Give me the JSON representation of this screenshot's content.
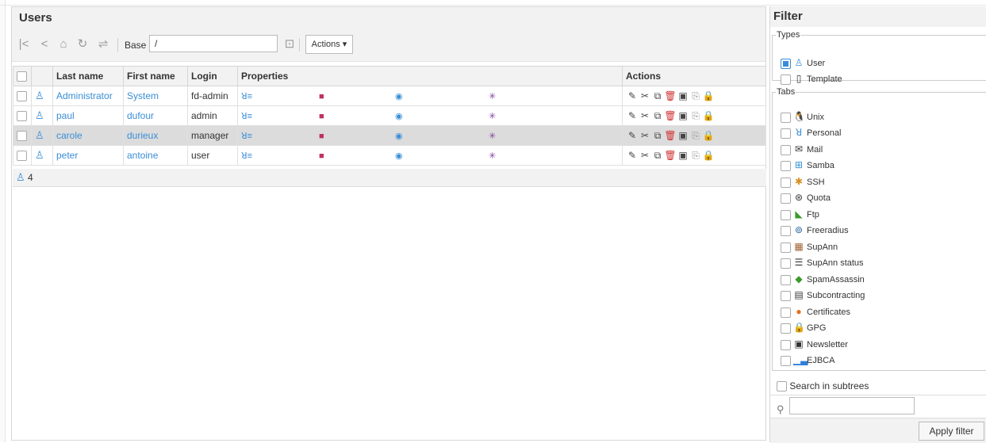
{
  "main": {
    "title": "Users",
    "toolbar": {
      "base_label": "Base",
      "base_value": "/",
      "actions_label": "Actions ▾"
    },
    "columns": [
      "Last name",
      "First name",
      "Login",
      "Properties",
      "Actions"
    ],
    "rows": [
      {
        "last": "Administrator",
        "first": "System",
        "login": "fd-admin",
        "selected": false
      },
      {
        "last": "paul",
        "first": "dufour",
        "login": "admin",
        "selected": false
      },
      {
        "last": "carole",
        "first": "durieux",
        "login": "manager",
        "selected": true
      },
      {
        "last": "peter",
        "first": "antoine",
        "login": "user",
        "selected": false
      }
    ],
    "footer_count": "4"
  },
  "filter": {
    "title": "Filter",
    "types_legend": "Types",
    "types": [
      {
        "label": "User",
        "checked": true,
        "icon": "user-icon"
      },
      {
        "label": "Template",
        "checked": false,
        "icon": "template-icon"
      }
    ],
    "tabs_legend": "Tabs",
    "tabs": [
      {
        "label": "Unix",
        "icon": "penguin-icon"
      },
      {
        "label": "Personal",
        "icon": "personal-icon"
      },
      {
        "label": "Mail",
        "icon": "mail-icon"
      },
      {
        "label": "Samba",
        "icon": "windows-icon"
      },
      {
        "label": "SSH",
        "icon": "ssh-icon"
      },
      {
        "label": "Quota",
        "icon": "quota-icon"
      },
      {
        "label": "Ftp",
        "icon": "ftp-icon"
      },
      {
        "label": "Freeradius",
        "icon": "freeradius-icon"
      },
      {
        "label": "SupAnn",
        "icon": "supann-icon"
      },
      {
        "label": "SupAnn status",
        "icon": "supann-status-icon"
      },
      {
        "label": "SpamAssassin",
        "icon": "spamassassin-icon"
      },
      {
        "label": "Subcontracting",
        "icon": "subcontracting-icon"
      },
      {
        "label": "Certificates",
        "icon": "certificate-icon"
      },
      {
        "label": "GPG",
        "icon": "gpg-icon"
      },
      {
        "label": "Newsletter",
        "icon": "newsletter-icon"
      },
      {
        "label": "EJBCA",
        "icon": "ejbca-icon"
      }
    ],
    "search_subtrees_label": "Search in subtrees",
    "search_value": "",
    "apply_label": "Apply filter"
  },
  "colors": {
    "accent": "#3a8ed6",
    "header_bg": "#f2f2f2",
    "selected_row": "#dcdcdc",
    "delete": "#d03030"
  }
}
